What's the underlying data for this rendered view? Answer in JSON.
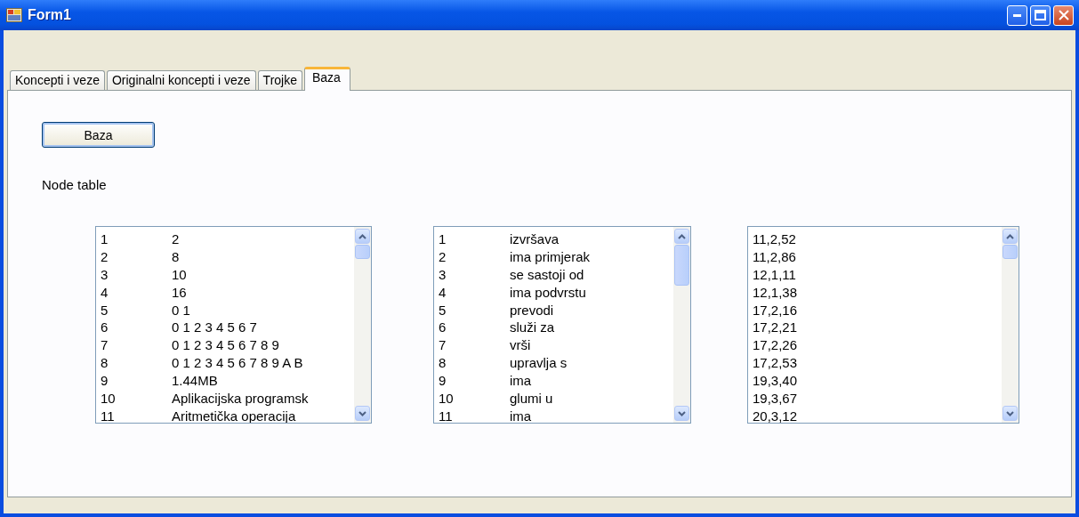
{
  "window": {
    "title": "Form1"
  },
  "tabs": [
    {
      "label": "Koncepti i veze",
      "selected": false
    },
    {
      "label": "Originalni koncepti i veze",
      "selected": false
    },
    {
      "label": "Trojke",
      "selected": false
    },
    {
      "label": "Baza",
      "selected": true
    }
  ],
  "button": {
    "label": "Baza"
  },
  "label": "Node table",
  "lists": [
    {
      "rows": [
        [
          "1",
          "2"
        ],
        [
          "2",
          "8"
        ],
        [
          "3",
          "10"
        ],
        [
          "4",
          "16"
        ],
        [
          "5",
          "0 1"
        ],
        [
          "6",
          "0 1 2 3 4 5 6 7"
        ],
        [
          "7",
          "0 1 2 3 4 5 6 7 8 9"
        ],
        [
          "8",
          "0 1 2 3 4 5 6 7 8 9 A B"
        ],
        [
          "9",
          "1.44MB"
        ],
        [
          "10",
          "Aplikacijska programsk"
        ],
        [
          "11",
          "Aritmetička operacija"
        ]
      ]
    },
    {
      "rows": [
        [
          "1",
          "izvršava"
        ],
        [
          "2",
          "ima primjerak"
        ],
        [
          "3",
          "se sastoji od"
        ],
        [
          "4",
          "ima podvrstu"
        ],
        [
          "5",
          "prevodi"
        ],
        [
          "6",
          "služi za"
        ],
        [
          "7",
          "vrši"
        ],
        [
          "8",
          "upravlja s"
        ],
        [
          "9",
          "ima"
        ],
        [
          "10",
          "glumi u"
        ],
        [
          "11",
          "ima"
        ]
      ]
    },
    {
      "rows": [
        [
          "11,2,52"
        ],
        [
          "11,2,86"
        ],
        [
          "12,1,11"
        ],
        [
          "12,1,38"
        ],
        [
          "17,2,16"
        ],
        [
          "17,2,21"
        ],
        [
          "17,2,26"
        ],
        [
          "17,2,53"
        ],
        [
          "19,3,40"
        ],
        [
          "19,3,67"
        ],
        [
          "20,3,12"
        ]
      ]
    }
  ]
}
